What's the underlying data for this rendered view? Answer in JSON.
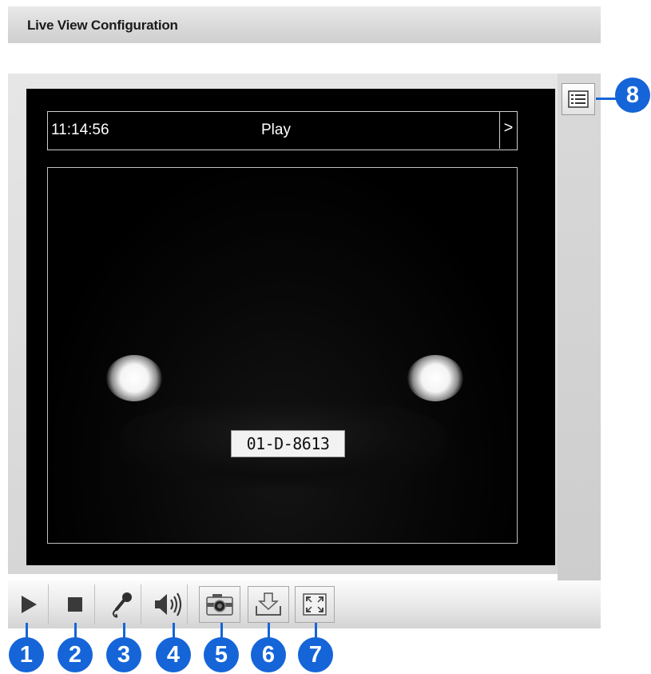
{
  "header": {
    "title": "Live View Configuration"
  },
  "osd": {
    "time": "11:14:56",
    "state": "Play",
    "next_glyph": ">"
  },
  "video": {
    "plate_text": "01-D-8613"
  },
  "side": {
    "list_button_icon": "list-icon"
  },
  "toolbar": {
    "buttons": [
      {
        "icon": "play-icon"
      },
      {
        "icon": "stop-icon"
      },
      {
        "icon": "microphone-icon"
      },
      {
        "icon": "speaker-icon"
      },
      {
        "icon": "camera-icon"
      },
      {
        "icon": "download-icon"
      },
      {
        "icon": "fullscreen-icon"
      }
    ]
  },
  "callouts": [
    "1",
    "2",
    "3",
    "4",
    "5",
    "6",
    "7",
    "8"
  ],
  "colors": {
    "callout": "#1565d8",
    "video_bg": "#000000"
  }
}
